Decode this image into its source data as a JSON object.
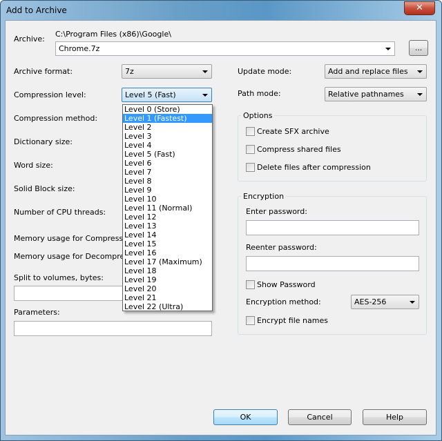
{
  "window": {
    "title": "Add to Archive",
    "close_icon": "close-icon"
  },
  "archive": {
    "label": "Archive:",
    "path": "C:\\Program Files (x86)\\Google\\",
    "value": "Chrome.7z",
    "browse_label": "..."
  },
  "left": {
    "archive_format": {
      "label": "Archive format:",
      "value": "7z"
    },
    "compression_level": {
      "label": "Compression level:",
      "value": "Level 5 (Fast)"
    },
    "compression_method": {
      "label": "Compression method:"
    },
    "dictionary_size": {
      "label": "Dictionary size:"
    },
    "word_size": {
      "label": "Word size:"
    },
    "solid_block_size": {
      "label": "Solid Block size:"
    },
    "cpu_threads": {
      "label": "Number of CPU threads:"
    },
    "mem_compress": {
      "label": "Memory usage for Compressing:"
    },
    "mem_decompress": {
      "label": "Memory usage for Decompressing:"
    },
    "split": {
      "label": "Split to volumes, bytes:",
      "value": ""
    },
    "parameters": {
      "label": "Parameters:",
      "value": ""
    }
  },
  "dropdown": {
    "selected_index": 1,
    "items": [
      "Level 0 (Store)",
      "Level 1 (Fastest)",
      "Level 2",
      "Level 3",
      "Level 4",
      "Level 5 (Fast)",
      "Level 6",
      "Level 7",
      "Level 8",
      "Level 9",
      "Level 10",
      "Level 11 (Normal)",
      "Level 12",
      "Level 13",
      "Level 14",
      "Level 15",
      "Level 16",
      "Level 17 (Maximum)",
      "Level 18",
      "Level 19",
      "Level 20",
      "Level 21",
      "Level 22 (Ultra)"
    ]
  },
  "right": {
    "update_mode": {
      "label": "Update mode:",
      "value": "Add and replace files"
    },
    "path_mode": {
      "label": "Path mode:",
      "value": "Relative pathnames"
    },
    "options": {
      "title": "Options",
      "items": [
        {
          "label": "Create SFX archive",
          "checked": false
        },
        {
          "label": "Compress shared files",
          "checked": false
        },
        {
          "label": "Delete files after compression",
          "checked": false
        }
      ]
    },
    "encryption": {
      "title": "Encryption",
      "enter_password": "Enter password:",
      "reenter_password": "Reenter password:",
      "show_password": "Show Password",
      "method_label": "Encryption method:",
      "method_value": "AES-256",
      "encrypt_names": "Encrypt file names"
    }
  },
  "buttons": {
    "ok": "OK",
    "cancel": "Cancel",
    "help": "Help"
  },
  "colors": {
    "selection": "#3399ff",
    "focus_border": "#3c7fb1"
  }
}
